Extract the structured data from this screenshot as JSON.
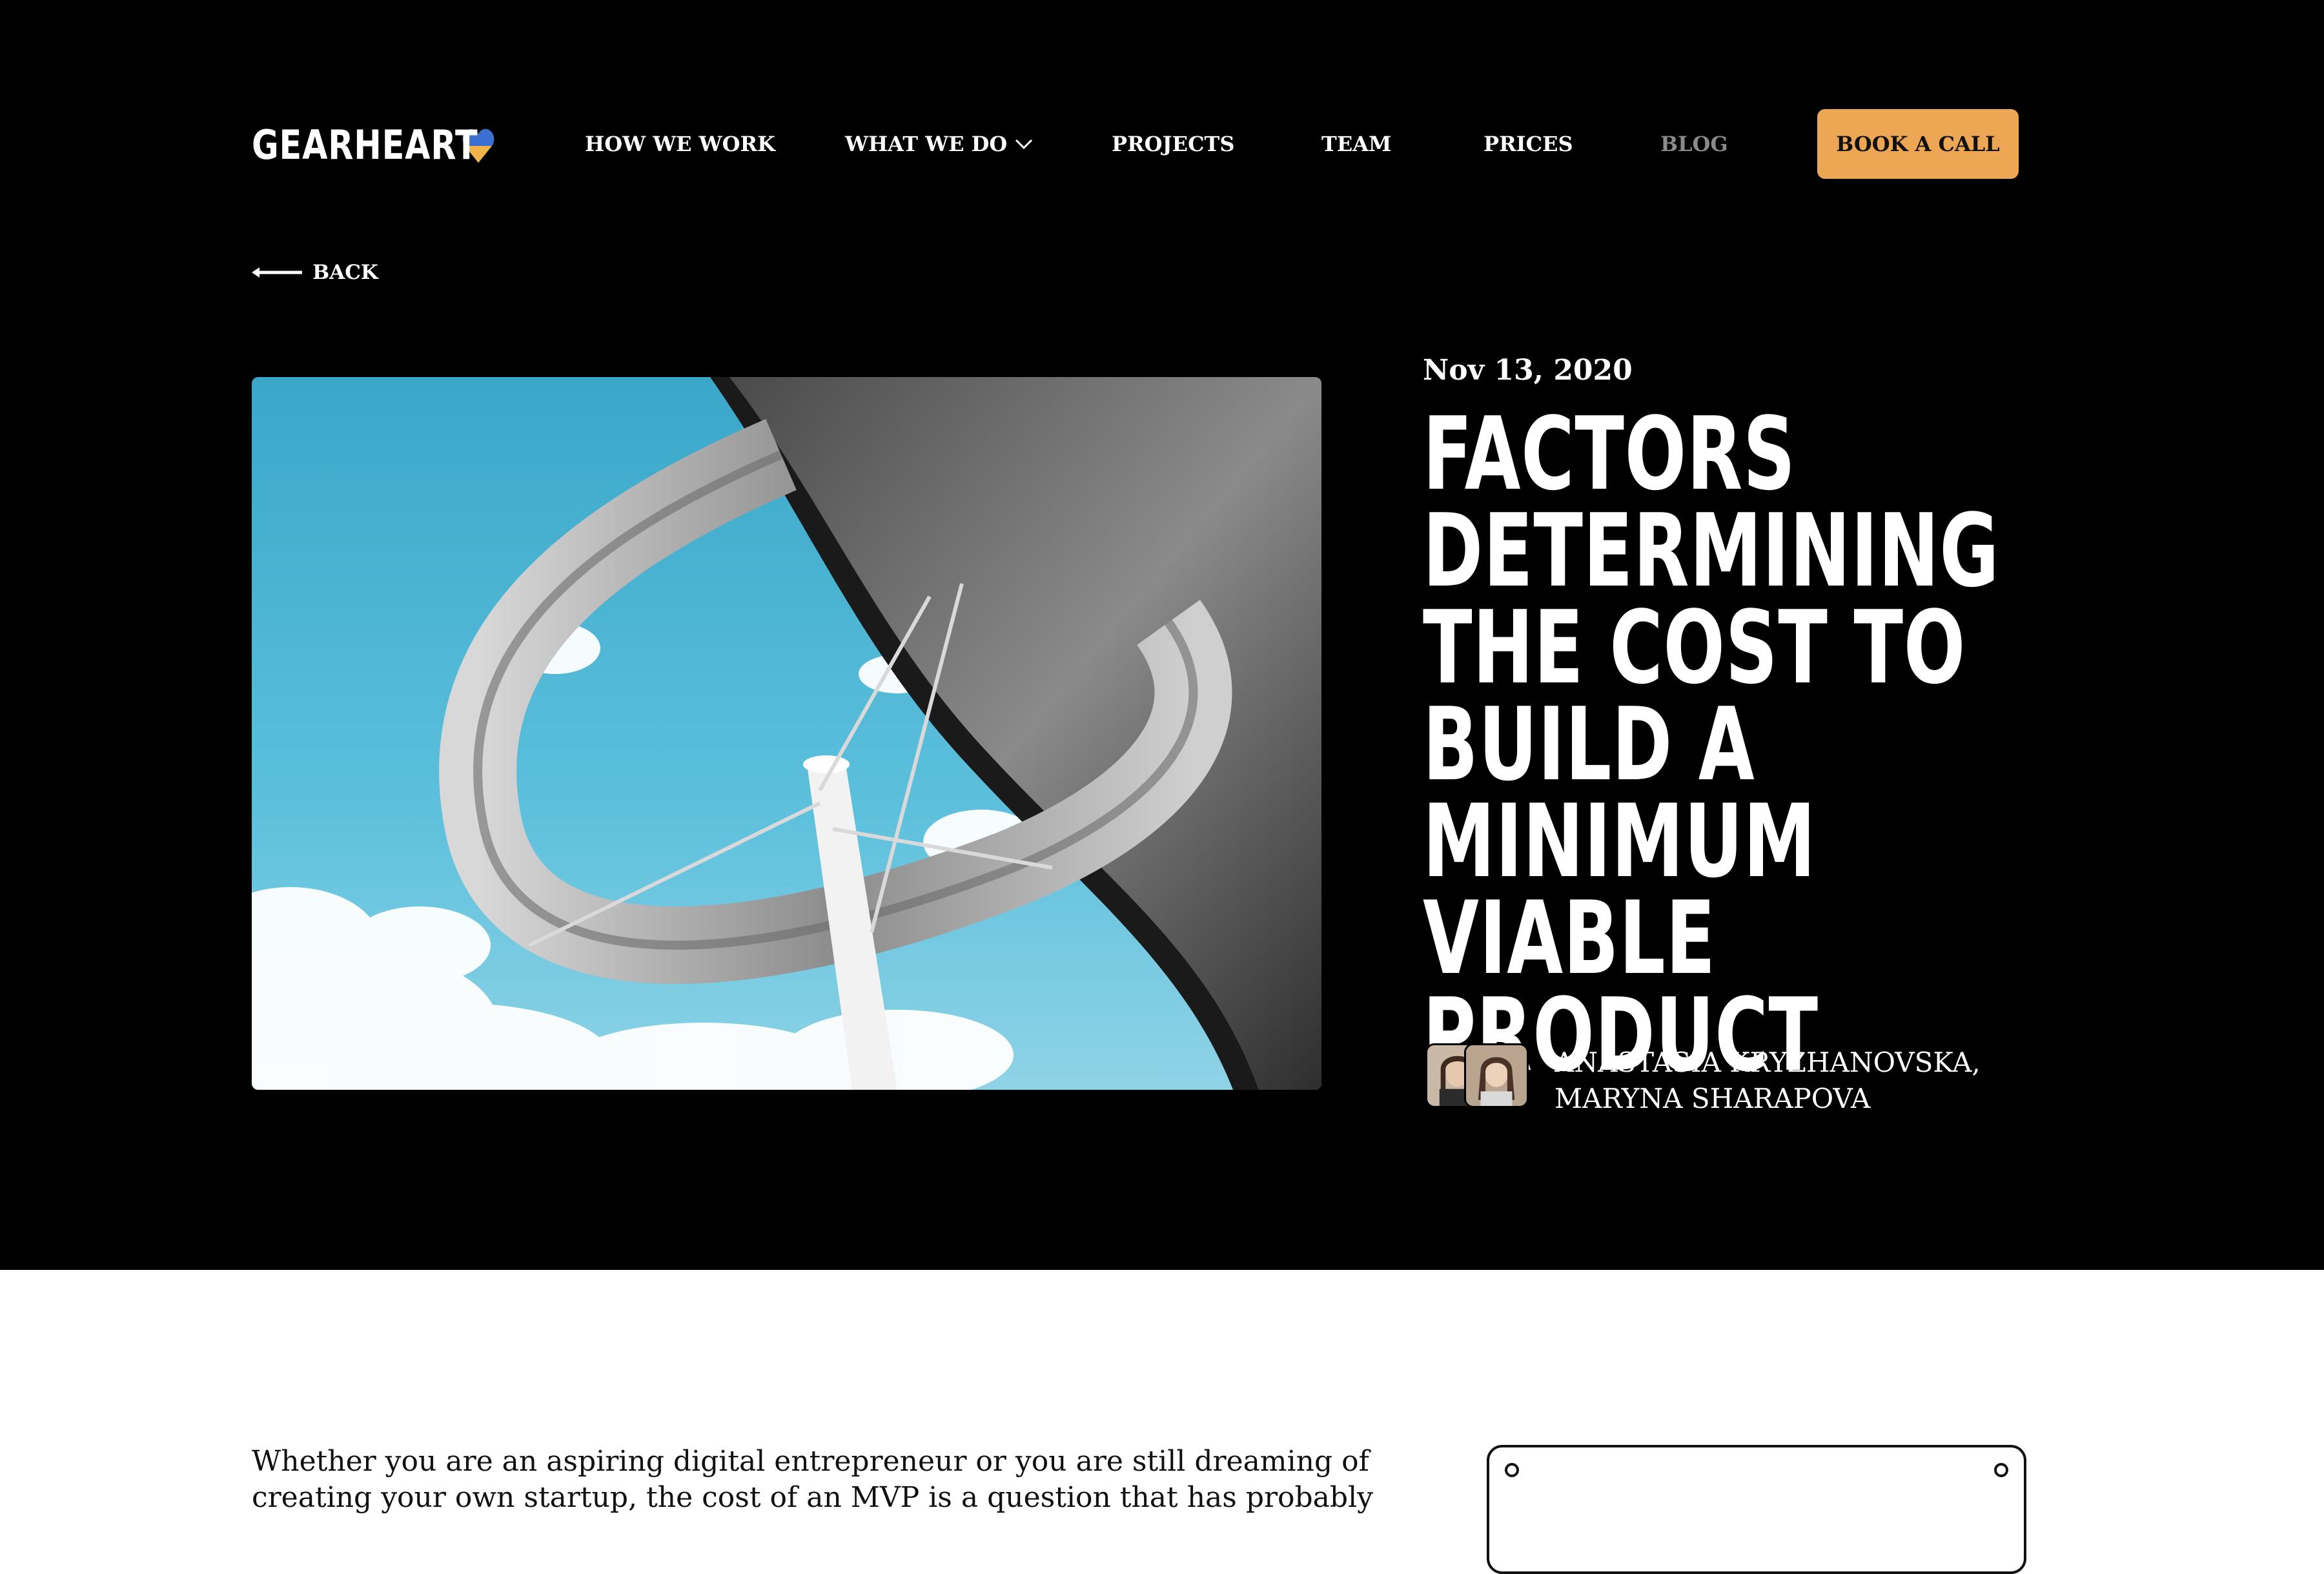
{
  "header": {
    "logo_text": "GEARHEART",
    "logo_icon": "ukraine-heart-icon",
    "nav": [
      {
        "label": "HOW WE WORK"
      },
      {
        "label": "WHAT WE DO",
        "icon": "chevron-down-icon"
      },
      {
        "label": "PROJECTS"
      },
      {
        "label": "TEAM"
      },
      {
        "label": "PRICES"
      },
      {
        "label": "BLOG",
        "state": "current"
      }
    ],
    "cta_label": "BOOK A CALL"
  },
  "back": {
    "label": "BACK",
    "icon": "arrow-left-icon"
  },
  "article": {
    "date": "Nov 13, 2020",
    "title": "FACTORS DETERMINING THE COST TO BUILD A MINIMUM VIABLE PRODUCT",
    "authors_line1": "ANASTASIA KRYZHANOVSKA,",
    "authors_line2": "MARYNA SHARAPOVA",
    "intro": "Whether you are an aspiring digital entrepreneur or you are still dreaming of creating your own startup, the cost of an MVP is a question that has probably"
  },
  "colors": {
    "background_dark": "#000000",
    "accent": "#eda653",
    "text_light": "#ffffff",
    "nav_muted": "#8a8a8a",
    "body_text": "#111111"
  }
}
